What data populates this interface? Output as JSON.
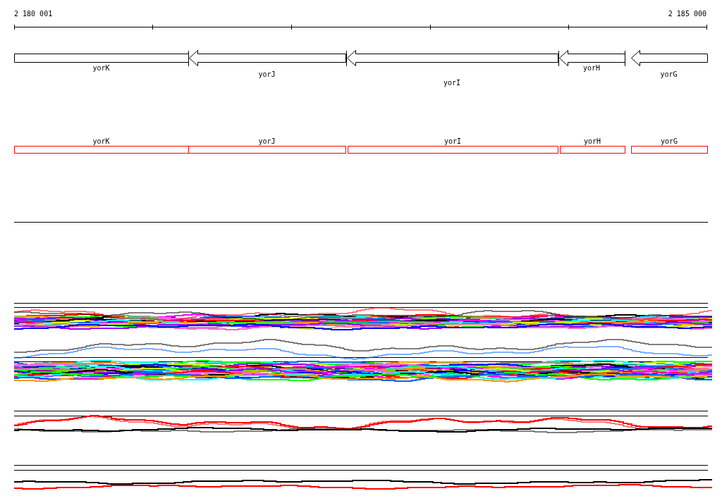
{
  "ruler": {
    "start_label": "2 180 001",
    "end_label": "2 185 000"
  },
  "genes": [
    {
      "name": "yorK",
      "kind": "box"
    },
    {
      "name": "yorJ",
      "kind": "arrow"
    },
    {
      "name": "yorI",
      "kind": "arrow"
    },
    {
      "name": "yorH",
      "kind": "arrow"
    },
    {
      "name": "yorG",
      "kind": "arrow"
    }
  ],
  "annotation_track": [
    {
      "label": "yorK"
    },
    {
      "label": "yorJ"
    },
    {
      "label": "yorI"
    },
    {
      "label": "yorH"
    },
    {
      "label": "yorG"
    }
  ]
}
